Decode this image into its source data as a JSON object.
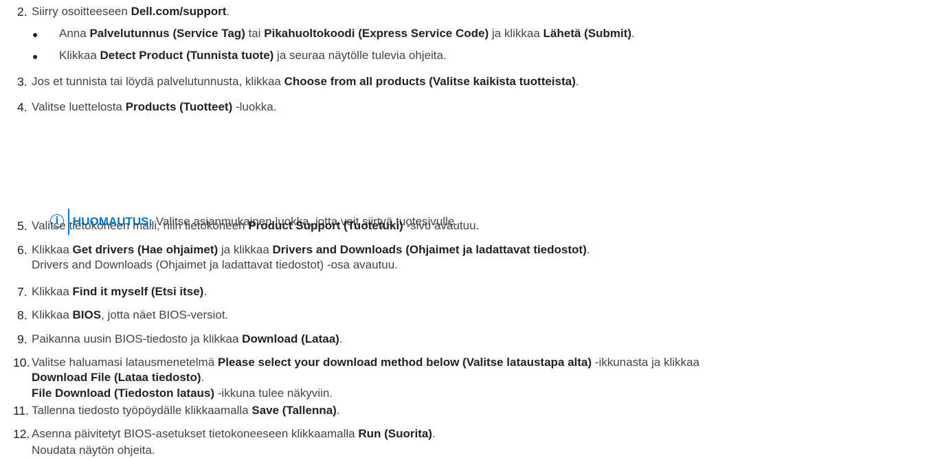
{
  "steps": [
    {
      "num": "2.",
      "parts": [
        "Siirry osoitteeseen ",
        "Dell.com/support",
        "."
      ]
    },
    {
      "bullet": "●",
      "parts": [
        "Anna ",
        "Palvelutunnus (Service Tag)",
        " tai ",
        "Pikahuoltokoodi (Express Service Code)",
        " ja klikkaa ",
        "Lähetä (Submit)",
        "."
      ]
    },
    {
      "bullet": "●",
      "parts": [
        "Klikkaa ",
        "Detect Product (Tunnista tuote)",
        " ja seuraa näytölle tulevia ohjeita."
      ]
    },
    {
      "num": "3.",
      "parts": [
        "Jos et tunnista tai löydä palvelutunnusta, klikkaa ",
        "Choose from all products (Valitse kaikista tuotteista)",
        "."
      ]
    },
    {
      "num": "4.",
      "parts": [
        "Valitse luettelosta ",
        "Products (Tuotteet)",
        " -luokka."
      ]
    },
    {
      "note_icon": "info-icon",
      "note_label": "HUOMAUTUS:",
      "note_text": " Valitse asianmukainen luokka, jotta voit siirtyä tuotesivulle."
    },
    {
      "num": "5.",
      "parts": [
        "Valitse tietokoneen malli, niin tietokoneen ",
        "Product Support (Tuotetuki)",
        " -sivu avautuu."
      ]
    },
    {
      "num": "6.",
      "parts": [
        "Klikkaa ",
        "Get drivers (Hae ohjaimet)",
        " ja klikkaa ",
        "Drivers and Downloads (Ohjaimet ja ladattavat tiedostot)",
        "."
      ]
    },
    {
      "cont": "Drivers and Downloads (Ohjaimet ja ladattavat tiedostot) -osa avautuu."
    },
    {
      "num": "7.",
      "parts": [
        "Klikkaa ",
        "Find it myself (Etsi itse)",
        "."
      ]
    },
    {
      "num": "8.",
      "parts": [
        "Klikkaa ",
        "BIOS",
        ", jotta näet BIOS-versiot."
      ]
    },
    {
      "num": "9.",
      "parts": [
        "Paikanna uusin BIOS-tiedosto ja klikkaa ",
        "Download (Lataa)",
        "."
      ]
    },
    {
      "num": "10.",
      "parts": [
        "Valitse haluamasi latausmenetelmä ",
        "Please select your download method below (Valitse lataustapa alta)",
        " -ikkunasta ja klikkaa"
      ]
    },
    {
      "cont_parts": [
        "",
        "Download File (Lataa tiedosto)",
        "."
      ]
    },
    {
      "cont_parts": [
        "",
        "File Download (Tiedoston lataus)",
        " -ikkuna tulee näkyviin."
      ]
    },
    {
      "num": "11.",
      "parts": [
        "Tallenna tiedosto työpöydälle klikkaamalla ",
        "Save (Tallenna)",
        "."
      ]
    },
    {
      "num": "12.",
      "parts": [
        "Asenna päivitetyt BIOS-asetukset tietokoneeseen klikkaamalla ",
        "Run (Suorita)",
        "."
      ]
    },
    {
      "cont": "Noudata näytön ohjeita."
    }
  ]
}
